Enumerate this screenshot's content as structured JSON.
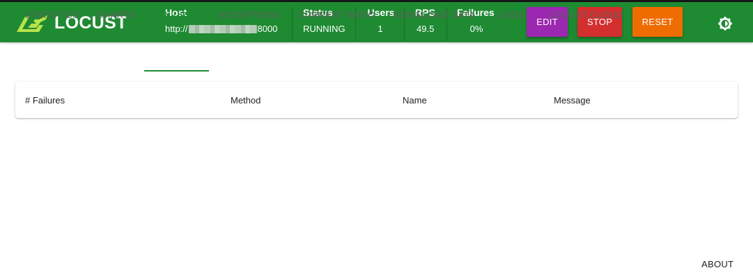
{
  "header": {
    "logo_text": "LOCUST",
    "host": {
      "label": "Host",
      "value_prefix": "http://",
      "value_suffix": "8000"
    },
    "status": {
      "label": "Status",
      "value": "RUNNING"
    },
    "users": {
      "label": "Users",
      "value": "1"
    },
    "rps": {
      "label": "RPS",
      "value": "49.5"
    },
    "failures": {
      "label": "Failures",
      "value": "0%"
    },
    "buttons": {
      "edit": "EDIT",
      "stop": "STOP",
      "reset": "RESET"
    },
    "colors": {
      "header_bg": "#1e8a32",
      "edit": "#9c27b0",
      "stop": "#d32f2f",
      "reset": "#ef6c00"
    }
  },
  "tabs": [
    {
      "label": "STATISTICS"
    },
    {
      "label": "CHARTS"
    },
    {
      "label": "FAILURES",
      "active": true
    },
    {
      "label": "EXCEPTIONS"
    },
    {
      "label": "CURRENT RATIO"
    },
    {
      "label": "DOWNLOAD DATA"
    },
    {
      "label": "LOGS"
    },
    {
      "label": "LOCUST CLOUD"
    }
  ],
  "failures_table": {
    "columns": [
      "# Failures",
      "Method",
      "Name",
      "Message"
    ],
    "rows": []
  },
  "footer": {
    "about": "ABOUT"
  },
  "icons": {
    "logo": "locust-logo-icon",
    "theme": "brightness-icon"
  }
}
